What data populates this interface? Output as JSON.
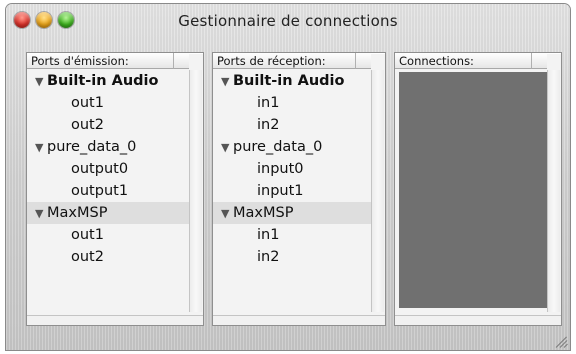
{
  "window": {
    "title": "Gestionnaire de connections"
  },
  "emission": {
    "header": "Ports d'émission:",
    "groups": [
      {
        "name": "Built-in Audio",
        "bold": true,
        "items": [
          "out1",
          "out2"
        ]
      },
      {
        "name": "pure_data_0",
        "bold": false,
        "items": [
          "output0",
          "output1"
        ]
      },
      {
        "name": "MaxMSP",
        "bold": false,
        "selected": true,
        "items": [
          "out1",
          "out2"
        ]
      }
    ]
  },
  "reception": {
    "header": "Ports de réception:",
    "groups": [
      {
        "name": "Built-in Audio",
        "bold": true,
        "items": [
          "in1",
          "in2"
        ]
      },
      {
        "name": "pure_data_0",
        "bold": false,
        "items": [
          "input0",
          "input1"
        ]
      },
      {
        "name": "MaxMSP",
        "bold": false,
        "selected": true,
        "items": [
          "in1",
          "in2"
        ]
      }
    ]
  },
  "connections": {
    "header": "Connections:"
  },
  "icons": {
    "expanded": "disclosure-triangle-down-icon",
    "close": "close-button-icon",
    "minimize": "minimize-button-icon",
    "zoom": "zoom-button-icon",
    "resize": "resize-grip-icon"
  },
  "colors": {
    "close": "#e0322b",
    "minimize": "#f0a81a",
    "zoom": "#3fb81e",
    "connections_area": "#707070",
    "selected_row": "#dedede"
  }
}
